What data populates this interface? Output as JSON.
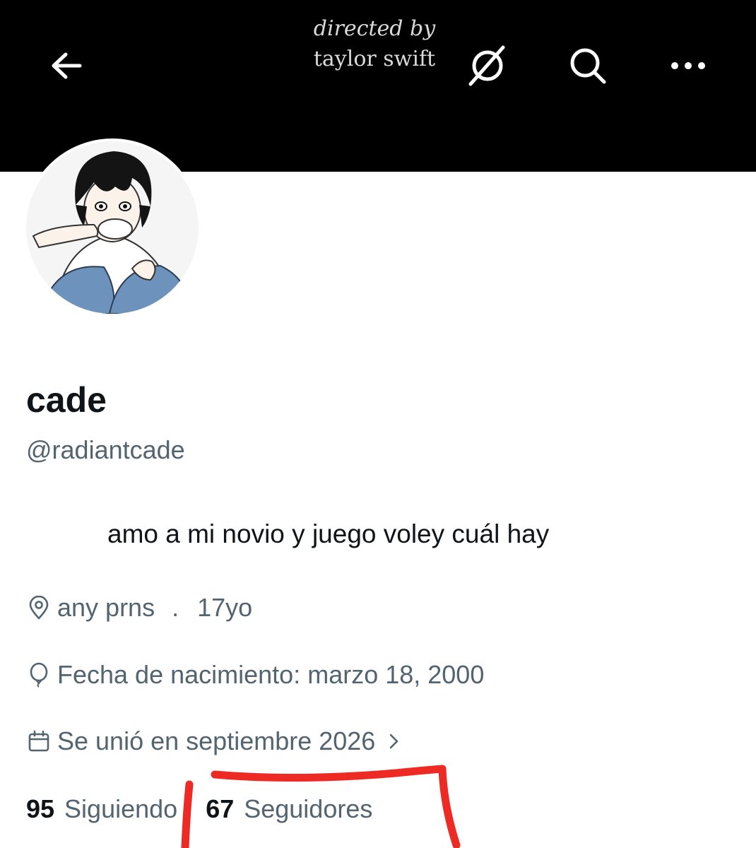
{
  "header": {
    "caption_line1": "directed by",
    "caption_line2": "taylor swift",
    "icons": {
      "back": "back-arrow-icon",
      "grok": "grok-icon",
      "search": "search-icon",
      "more": "more-options-icon"
    }
  },
  "profile": {
    "display_name": "cade",
    "handle": "@radiantcade",
    "bio": "amo a mi novio y juego voley cuál hay",
    "location": "any prns",
    "separator": ".",
    "age": "17yo",
    "birthdate": "Fecha de nacimiento: marzo 18, 2000",
    "joined": "Se unió en septiembre 2026",
    "following_count": "95",
    "following_label": "Siguiendo",
    "followers_count": "67",
    "followers_label": "Seguidores"
  },
  "colors": {
    "banner": "#000000",
    "primary_text": "#0f1419",
    "secondary_text": "#536471",
    "annotation": "#ee2a24"
  }
}
